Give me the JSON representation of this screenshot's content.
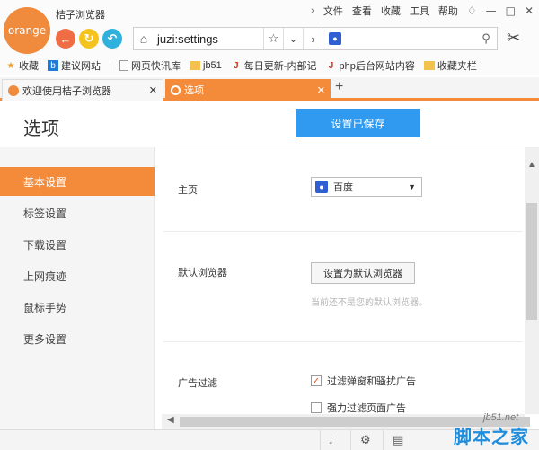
{
  "browser": {
    "logo_text": "orange",
    "title": "桔子浏览器",
    "menus": [
      "文件",
      "查看",
      "收藏",
      "工具",
      "帮助"
    ],
    "address": "juzi:settings",
    "search_engine_icon": "paw-icon"
  },
  "bookmarks": [
    {
      "label": "收藏",
      "icon": "star-icon"
    },
    {
      "label": "建议网站",
      "icon": "bing-icon"
    },
    {
      "label": "网页快讯库",
      "icon": "page-icon"
    },
    {
      "label": "jb51",
      "icon": "folder-icon"
    },
    {
      "label": "每日更新-内部记",
      "icon": "jb-icon"
    },
    {
      "label": "php后台网站内容",
      "icon": "jb-icon"
    },
    {
      "label": "收藏夹栏",
      "icon": "folder-icon"
    }
  ],
  "tabs": [
    {
      "label": "欢迎使用桔子浏览器",
      "active": false
    },
    {
      "label": "选项",
      "active": true
    }
  ],
  "page": {
    "title": "选项",
    "saved_button": "设置已保存"
  },
  "sidebar": {
    "items": [
      {
        "label": "基本设置",
        "active": true
      },
      {
        "label": "标签设置",
        "active": false
      },
      {
        "label": "下载设置",
        "active": false
      },
      {
        "label": "上网痕迹",
        "active": false
      },
      {
        "label": "鼠标手势",
        "active": false
      },
      {
        "label": "更多设置",
        "active": false
      }
    ]
  },
  "settings": {
    "homepage": {
      "label": "主页",
      "value": "百度"
    },
    "default_browser": {
      "label": "默认浏览器",
      "button": "设置为默认浏览器",
      "hint": "当前还不是您的默认浏览器。"
    },
    "ad_filter": {
      "label": "广告过滤",
      "options": [
        {
          "label": "过滤弹窗和骚扰广告",
          "checked": true
        },
        {
          "label": "强力过滤页面广告",
          "checked": false
        }
      ]
    }
  },
  "watermark": {
    "url": "jb51.net",
    "text": "脚本之家"
  },
  "colors": {
    "accent": "#f48b3b",
    "primary_button": "#2f9af0"
  }
}
